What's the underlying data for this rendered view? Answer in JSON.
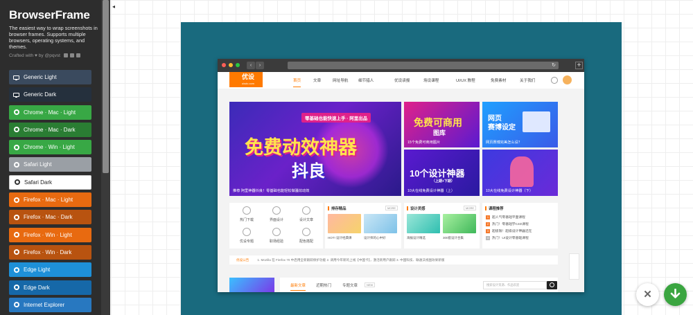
{
  "app": {
    "title": "BrowserFrame",
    "tagline": "The easiest way to wrap screenshots in browser frames. Supports multiple browsers, operating systems, and themes.",
    "crafted": "Crafted with ♥ by @pqvst"
  },
  "menu": [
    {
      "label": "Generic Light",
      "icon": "monitor-icon",
      "color": "#3a4a5e"
    },
    {
      "label": "Generic Dark",
      "icon": "monitor-icon",
      "color": "#25303d"
    },
    {
      "label": "Chrome · Mac · Light",
      "icon": "chrome-icon",
      "color": "#38a845"
    },
    {
      "label": "Chrome · Mac · Dark",
      "icon": "chrome-icon",
      "color": "#2a7d33"
    },
    {
      "label": "Chrome · Win · Light",
      "icon": "chrome-icon",
      "color": "#38a845"
    },
    {
      "label": "Safari Light",
      "icon": "safari-icon",
      "color": "#9a9fa5"
    },
    {
      "label": "Safari Dark",
      "icon": "safari-icon",
      "color": "#ffffff"
    },
    {
      "label": "Firefox · Mac · Light",
      "icon": "firefox-icon",
      "color": "#e86a10"
    },
    {
      "label": "Firefox · Mac · Dark",
      "icon": "firefox-icon",
      "color": "#b85310"
    },
    {
      "label": "Firefox · Win · Light",
      "icon": "firefox-icon",
      "color": "#e86a10"
    },
    {
      "label": "Firefox · Win · Dark",
      "icon": "firefox-icon",
      "color": "#b85310"
    },
    {
      "label": "Edge Light",
      "icon": "edge-icon",
      "color": "#1e90d8"
    },
    {
      "label": "Edge Dark",
      "icon": "edge-icon",
      "color": "#1668a8"
    },
    {
      "label": "Internet Explorer",
      "icon": "ie-icon",
      "color": "#2878c0"
    }
  ],
  "site": {
    "logo": "优设",
    "logo_sub": "uisdc.com",
    "nav": [
      "首页",
      "文章",
      "网址导航",
      "细节猎人",
      "优设读报",
      "场设课程",
      "UI/UX 教程",
      "免费素材",
      "关于我们"
    ],
    "banner_main": {
      "big": "免费动效神器",
      "big2": "抖良",
      "small": "零基础也能快速上手 · 阿里出品",
      "caption": "推荐  阿里神器抖良！零基础也能轻松做骚炫动效"
    },
    "banners": [
      {
        "big": "免费可商用",
        "sub": "图库",
        "caption": "15个免费可商用图片"
      },
      {
        "big": "网页",
        "sub": "赛博设定",
        "caption": "网页赛博完美怎么设？"
      },
      {
        "big": "10个设计神器",
        "sub": "（上期+下期）",
        "caption": "10大在线免费设计神器（上）"
      },
      {
        "big": "",
        "sub": "",
        "caption": "10大在线免费设计神器（下）"
      }
    ],
    "quick": [
      "热门下载",
      "界面设计",
      "设计文章",
      "优设专题",
      "职场经验",
      "配色搭配"
    ],
    "sec1": {
      "title": "排存精品",
      "more": "MORE",
      "items": [
        "HOT! 设计经典课",
        "设计师的心中好"
      ]
    },
    "sec2": {
      "title": "设计灵感",
      "more": "MORE",
      "items": [
        "海报设计精选",
        "300套设计合集"
      ]
    },
    "sec3": {
      "title": "课程推荐",
      "items": [
        "超人气零基础平面课程",
        "热门！零基础学C4D课程",
        "超极限！超级设计神器还在",
        "热门！UI设计零基础课程"
      ]
    },
    "notice": {
      "label": "优设公告",
      "text": "1. Mozilla 在 Firefox 70 中启用全新跟踪保护功能    2. 调用今年新的上线【中国卡】，激活新用户跟踪    3. 中国科技、联通沃视图效果新版"
    },
    "tabs": [
      "最新文章",
      "近期热门",
      "专题文章"
    ],
    "tab_badge": "NEW",
    "search_placeholder": "搜索设计资源、作品欢迎"
  }
}
